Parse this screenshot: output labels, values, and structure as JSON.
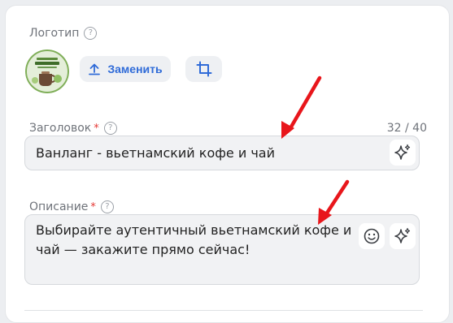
{
  "logo": {
    "label": "Логотип",
    "help_icon": "?",
    "replace_label": "Заменить"
  },
  "title_field": {
    "label": "Заголовок",
    "required_mark": "*",
    "help_icon": "?",
    "counter": "32 / 40",
    "value": "Ванланг - вьетнамский кофе и чай"
  },
  "description_field": {
    "label": "Описание",
    "required_mark": "*",
    "help_icon": "?",
    "value": "Выбирайте аутентичный вьетнамский кофе и чай — закажите прямо сейчас!"
  },
  "colors": {
    "accent": "#2f6bd8",
    "required": "#e53935",
    "annotation_arrow": "#e8161b"
  },
  "icons": [
    "help-icon",
    "upload-icon",
    "crop-icon",
    "sparkle-icon",
    "emoji-icon"
  ]
}
